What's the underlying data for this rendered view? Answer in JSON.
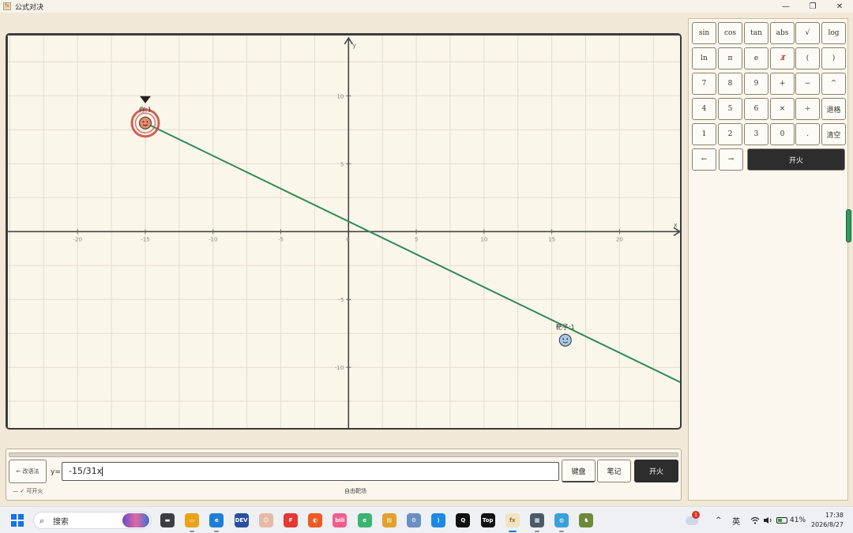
{
  "window": {
    "title": "公式对决",
    "app_icon": "fx-app-icon"
  },
  "window_controls": {
    "minimize": "—",
    "maximize": "❐",
    "close": "✕"
  },
  "graph": {
    "x_axis_label": "x",
    "y_axis_label": "y",
    "x_ticks": [
      -20,
      -15,
      -10,
      -5,
      0,
      5,
      10,
      15,
      20
    ],
    "y_ticks": [
      10,
      5,
      -5,
      -10
    ],
    "x_range": [
      -25.2,
      24.7
    ],
    "y_range": [
      -14.7,
      14.5
    ],
    "player": {
      "label": "你:1",
      "x": -15,
      "y": 8,
      "color": "#c9473e"
    },
    "target": {
      "label": "靶子:1",
      "x": 16,
      "y": -8,
      "color": "#3a6fa5"
    },
    "shot_line": {
      "from": [
        -15,
        8
      ],
      "to": [
        24.7,
        -11.2
      ],
      "color": "#2e8b57"
    }
  },
  "keypad": {
    "rows": [
      [
        "sin",
        "cos",
        "tan",
        "abs",
        "√",
        "log"
      ],
      [
        "ln",
        "π",
        "e",
        "𝔛",
        "(",
        ")"
      ],
      [
        "7",
        "8",
        "9",
        "+",
        "−",
        "^"
      ],
      [
        "4",
        "5",
        "6",
        "×",
        "÷",
        "退格"
      ],
      [
        "1",
        "2",
        "3",
        "0",
        ".",
        "清空"
      ]
    ],
    "arrow_left": "←",
    "arrow_right": "→",
    "fire": "开火"
  },
  "input_bar": {
    "back_label": "← 改语法",
    "prefix": "y=",
    "formula": "-15/31x",
    "keyboard_btn": "键盘",
    "notes_btn": "笔记",
    "fire_btn": "开火",
    "status": "—  ✓ 可开火",
    "mode": "自由靶场"
  },
  "taskbar": {
    "search_placeholder": "搜索",
    "weather_badge": "1",
    "ime": "英",
    "battery": "41%",
    "time": "17:38",
    "date": "2026/8/27",
    "apps": [
      "file-manager-icon",
      "folder-icon",
      "edge-icon",
      "devhome-icon",
      "avatar-app-icon",
      "feishu-icon",
      "orange-app-icon",
      "bilibili-icon",
      "e-browser-icon",
      "notes-app-icon",
      "gear-app-icon",
      "vscode-icon",
      "qq-icon",
      "top-app-icon",
      "fx-app-icon",
      "calculator-icon",
      "globe-icon",
      "game-icon"
    ]
  }
}
